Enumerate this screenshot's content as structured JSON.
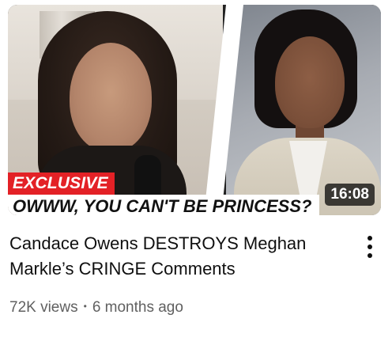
{
  "video": {
    "thumbnail": {
      "tag": "EXCLUSIVE",
      "caption": "OWWW, YOU CAN'T BE PRINCESS?",
      "duration": "16:08"
    },
    "title": "Candace Owens DESTROYS Meghan Markle’s CRINGE Comments",
    "views": "72K views",
    "separator": "•",
    "age": "6 months ago",
    "menu_icon": "more-vert-icon"
  },
  "colors": {
    "tag_background": "#e32126",
    "title_text": "#0f0f0f",
    "meta_text": "#606060",
    "duration_background": "#000000"
  }
}
